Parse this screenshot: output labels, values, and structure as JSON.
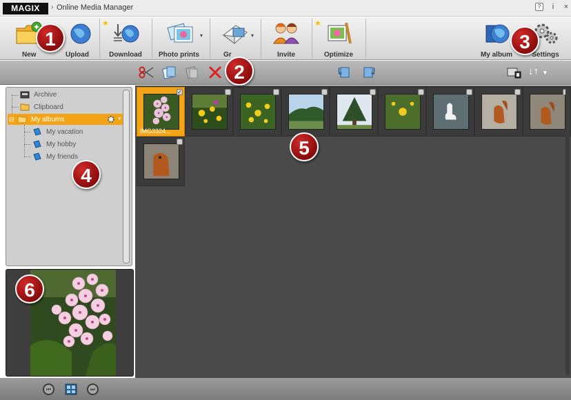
{
  "titlebar": {
    "logo": "MAGIX",
    "separator": "›",
    "title": "Online Media Manager",
    "buttons": [
      "?",
      "i",
      "×"
    ]
  },
  "toolbar": {
    "buttons": [
      {
        "label": "New",
        "icon": "new-folder-icon"
      },
      {
        "label": "Upload",
        "icon": "upload-globe-icon"
      },
      {
        "label": "Download",
        "icon": "download-globe-icon",
        "starred": true
      },
      {
        "label": "Photo prints",
        "icon": "photo-prints-icon"
      },
      {
        "label": "Gr",
        "icon": "greeting-card-icon"
      },
      {
        "label": "Invite",
        "icon": "invite-people-icon"
      },
      {
        "label": "Optimize",
        "icon": "optimize-photo-icon",
        "starred": true
      },
      {
        "label": "My album",
        "icon": "my-album-globe-icon"
      },
      {
        "label": "Settings",
        "icon": "settings-gear-icon"
      }
    ],
    "star_glyph": "★",
    "dropdown_glyph": "▾"
  },
  "toolbar2": {
    "icons": [
      "cut-icon",
      "copy-icon",
      "paste-icon",
      "delete-icon",
      "rotate-left-icon",
      "rotate-right-icon",
      "view-mode-icon",
      "sort-icon"
    ],
    "sort_glyph": "↓↑"
  },
  "tree": {
    "items": [
      {
        "label": "Archive",
        "icon": "archive-icon"
      },
      {
        "label": "Clipboard",
        "icon": "clipboard-folder-icon"
      },
      {
        "label": "My albums",
        "icon": "albums-folder-icon",
        "selected": true
      },
      {
        "label": "My vacation",
        "icon": "album-book-icon"
      },
      {
        "label": "My hobby",
        "icon": "album-book-icon"
      },
      {
        "label": "My friends",
        "icon": "album-book-icon"
      }
    ],
    "expander": "⊟"
  },
  "thumbnails": [
    {
      "caption": "IMG3324...",
      "selected": true,
      "checked": "✓",
      "kind": "phlox"
    },
    {
      "caption": "",
      "selected": false,
      "kind": "yellow-flowers"
    },
    {
      "caption": "",
      "selected": false,
      "kind": "yellow-flowers-2"
    },
    {
      "caption": "",
      "selected": false,
      "kind": "tree-landscape"
    },
    {
      "caption": "",
      "selected": false,
      "kind": "pine-tree"
    },
    {
      "caption": "",
      "selected": false,
      "kind": "yellow-flowers-3"
    },
    {
      "caption": "",
      "selected": false,
      "kind": "swan"
    },
    {
      "caption": "",
      "selected": false,
      "kind": "squirrel"
    },
    {
      "caption": "",
      "selected": false,
      "kind": "squirrel-2"
    },
    {
      "caption": "",
      "selected": false,
      "kind": "squirrel-3"
    }
  ],
  "statusbar": {
    "prev_glyph": "⏮",
    "next_glyph": "⏭"
  },
  "callouts": [
    "1",
    "2",
    "3",
    "4",
    "5",
    "6"
  ],
  "colors": {
    "accent": "#f3a417",
    "callout": "#a01414",
    "main_bg": "#4a4a4a"
  }
}
